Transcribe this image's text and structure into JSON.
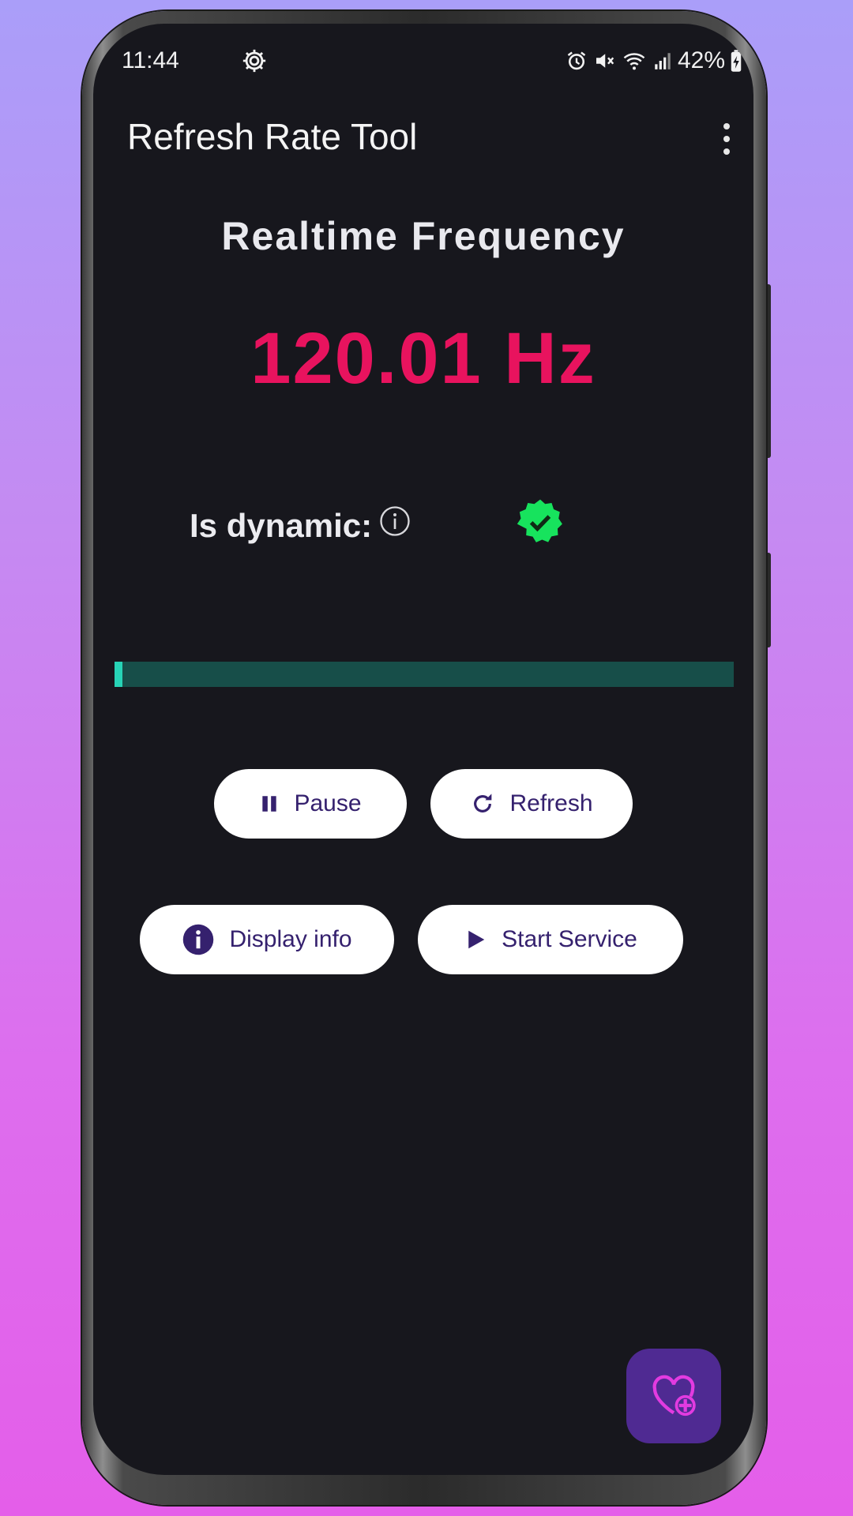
{
  "status_bar": {
    "time": "11:44",
    "battery": "42%",
    "icons": [
      "settings-gear-icon",
      "alarm-icon",
      "mute-icon",
      "wifi-icon",
      "signal-icon",
      "battery-charging-icon"
    ]
  },
  "app_bar": {
    "title": "Refresh Rate Tool",
    "menu_icon": "more-vert-icon"
  },
  "main": {
    "heading": "Realtime Frequency",
    "frequency": "120.01 Hz",
    "dynamic_label": "Is dynamic:",
    "dynamic_status_icon": "verified-check-icon",
    "progress_fraction": 0.013
  },
  "buttons": {
    "pause": "Pause",
    "refresh": "Refresh",
    "display_info": "Display info",
    "start_service": "Start Service"
  },
  "fab": {
    "icon": "heart-plus-icon"
  },
  "colors": {
    "background": "#17171d",
    "frequency": "#e8135e",
    "badge": "#17e35d",
    "progress_track": "#174e49",
    "progress_fill": "#27d3b6",
    "button_text": "#35216e",
    "fab": "#4f2a92",
    "fab_icon": "#e23be0"
  }
}
